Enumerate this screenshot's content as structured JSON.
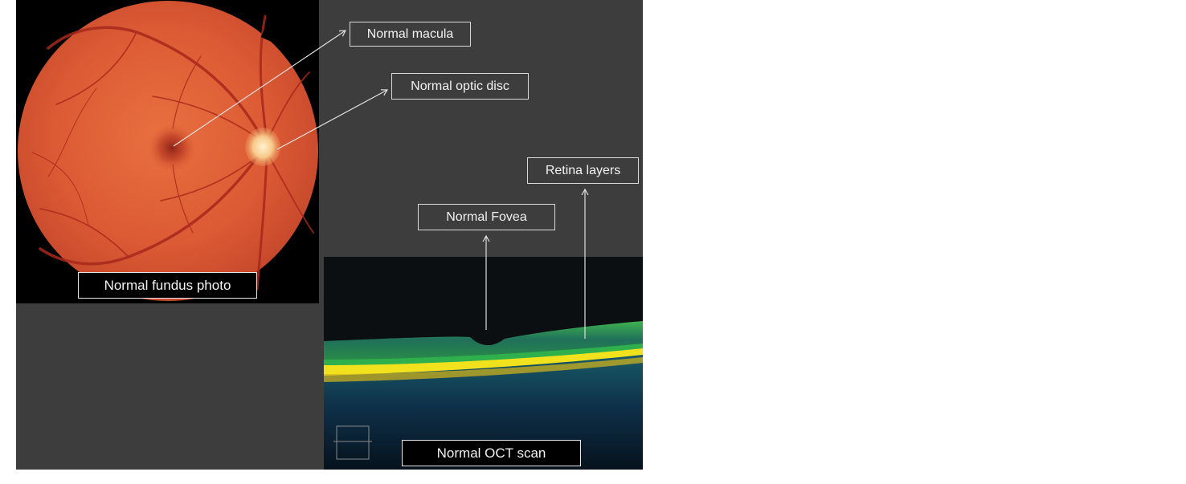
{
  "figure": {
    "colors": {
      "panel_background": "#3d3d3d",
      "photo_background": "#000000",
      "fundus": "#e0613a",
      "oct_retina": "#2e9c4a",
      "oct_rpe": "#f2e21e"
    },
    "annotations": {
      "macula": "Normal macula",
      "optic_disc": "Normal optic disc",
      "retina_layers": "Retina layers",
      "fovea": "Normal Fovea"
    },
    "captions": {
      "fundus": "Normal fundus photo",
      "oct": "Normal OCT scan"
    }
  }
}
